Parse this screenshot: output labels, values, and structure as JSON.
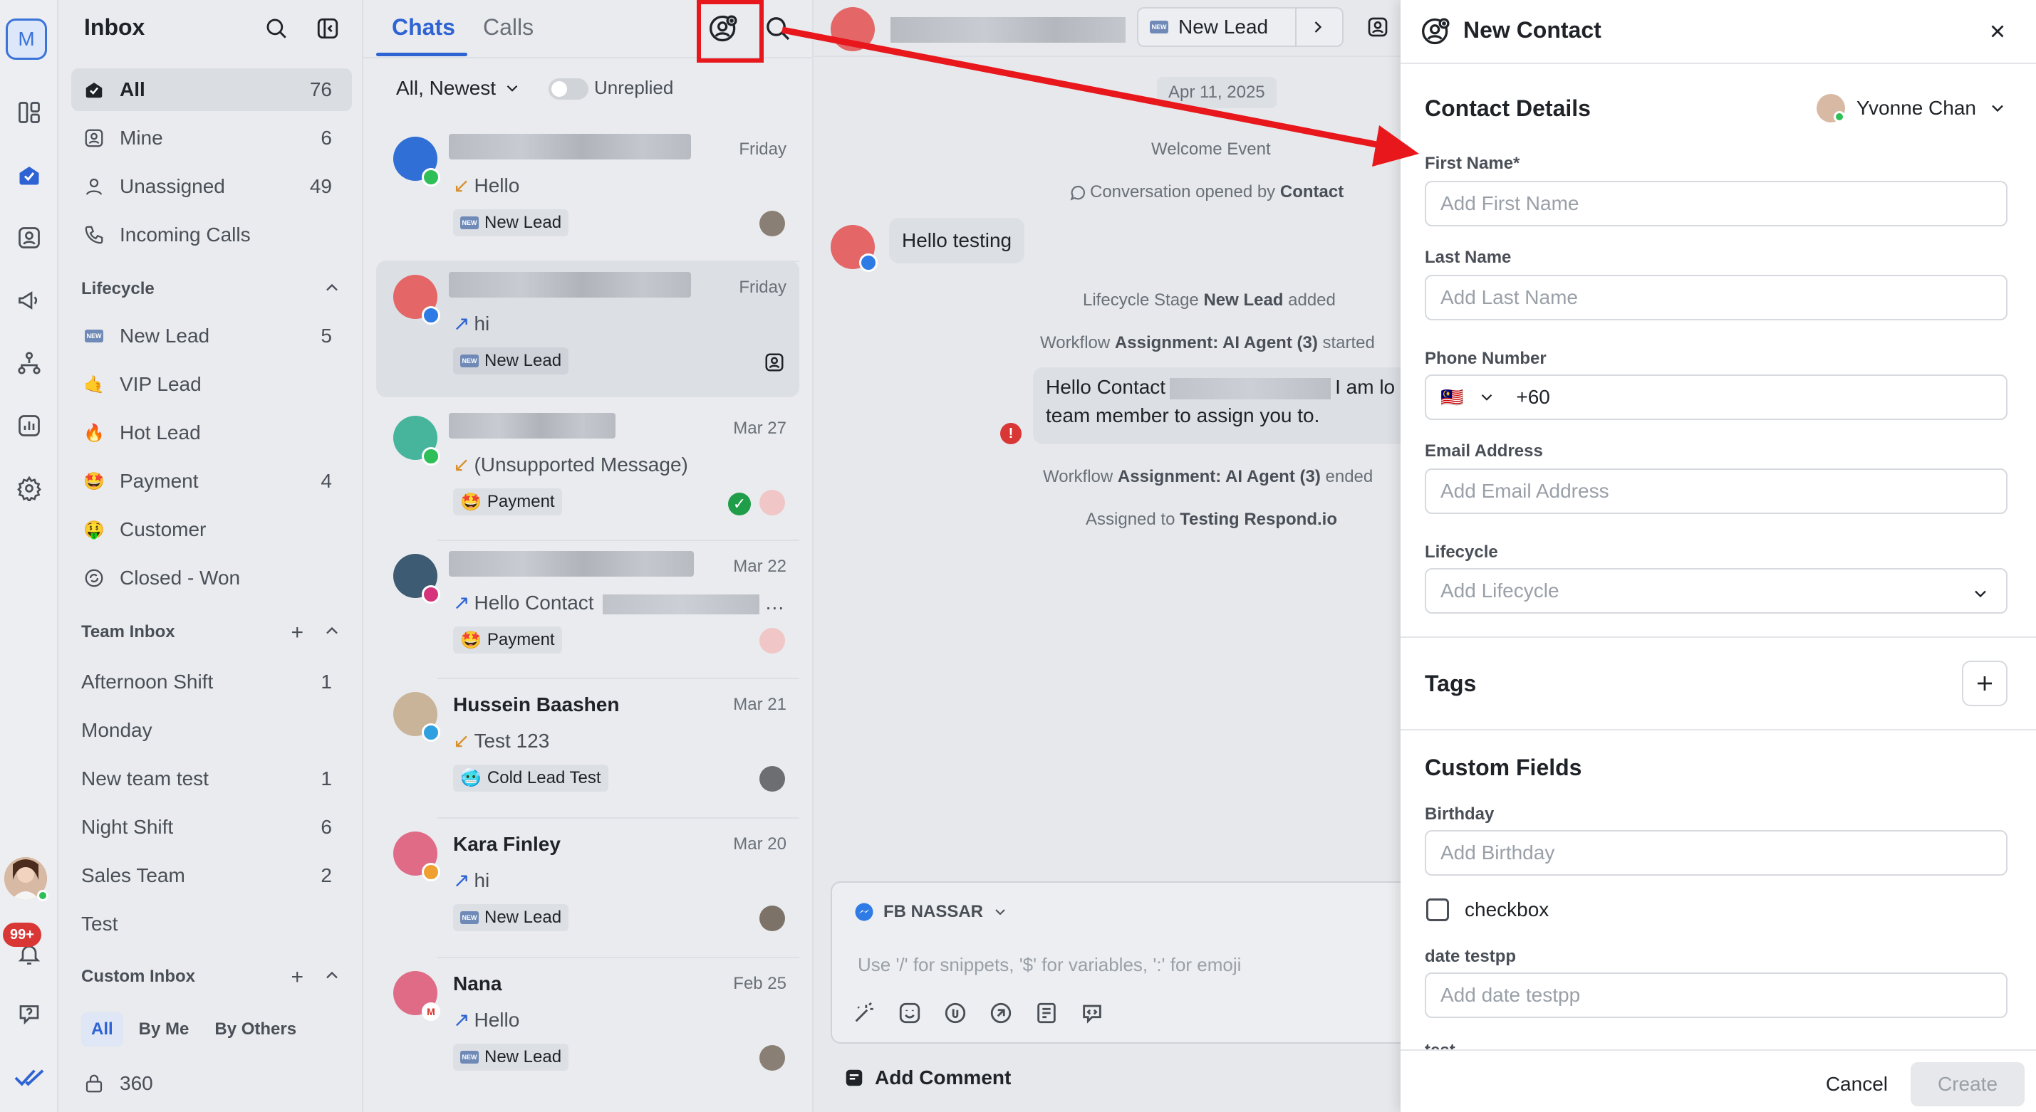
{
  "rail": {
    "workspace_initial": "M",
    "notification_count": "99+",
    "icons": [
      "dashboard-icon",
      "inbox-icon",
      "contacts-icon",
      "broadcast-icon",
      "workflows-icon",
      "reports-icon",
      "settings-icon",
      "help-icon",
      "brand-check-icon"
    ]
  },
  "inbox": {
    "title": "Inbox",
    "views": [
      {
        "label": "All",
        "count": "76"
      },
      {
        "label": "Mine",
        "count": "6"
      },
      {
        "label": "Unassigned",
        "count": "49"
      },
      {
        "label": "Incoming Calls",
        "count": ""
      }
    ],
    "lifecycle_header": "Lifecycle",
    "lifecycle": [
      {
        "label": "New Lead",
        "count": "5",
        "emoji": "🆕"
      },
      {
        "label": "VIP Lead",
        "count": "",
        "emoji": "🤙"
      },
      {
        "label": "Hot Lead",
        "count": "",
        "emoji": "🔥"
      },
      {
        "label": "Payment",
        "count": "4",
        "emoji": "🤩"
      },
      {
        "label": "Customer",
        "count": "",
        "emoji": "🤑"
      },
      {
        "label": "Closed - Won",
        "count": "",
        "emoji": ""
      }
    ],
    "team_header": "Team Inbox",
    "teams": [
      {
        "label": "Afternoon Shift",
        "count": "1"
      },
      {
        "label": "Monday",
        "count": ""
      },
      {
        "label": "New team test",
        "count": "1"
      },
      {
        "label": "Night Shift",
        "count": "6"
      },
      {
        "label": "Sales Team",
        "count": "2"
      },
      {
        "label": "Test",
        "count": ""
      }
    ],
    "custom_header": "Custom Inbox",
    "custom_tabs": [
      "All",
      "By Me",
      "By Others"
    ],
    "custom_items": [
      {
        "label": "360"
      }
    ]
  },
  "chats": {
    "tabs": [
      "Chats",
      "Calls"
    ],
    "filter_label": "All, Newest",
    "unreplied_label": "Unreplied",
    "items": [
      {
        "name": "",
        "date": "Friday",
        "message": "Hello",
        "direction": "in",
        "tag": "New Lead",
        "tag_emoji": "🆕"
      },
      {
        "name": "",
        "date": "Friday",
        "message": "hi",
        "direction": "out",
        "tag": "New Lead",
        "tag_emoji": "🆕"
      },
      {
        "name": "",
        "date": "Mar 27",
        "message": "(Unsupported Message)",
        "direction": "in",
        "tag": "Payment",
        "tag_emoji": "🤩"
      },
      {
        "name": "",
        "date": "Mar 22",
        "message": "Hello Contact",
        "direction": "out",
        "tag": "Payment",
        "tag_emoji": "🤩"
      },
      {
        "name": "Hussein Baashen",
        "date": "Mar 21",
        "message": "Test 123",
        "direction": "in",
        "tag": "Cold Lead Test",
        "tag_emoji": "🥶"
      },
      {
        "name": "Kara Finley",
        "date": "Mar 20",
        "message": "hi",
        "direction": "out",
        "tag": "New Lead",
        "tag_emoji": "🆕"
      },
      {
        "name": "Nana",
        "date": "Feb 25",
        "message": "Hello",
        "direction": "out",
        "tag": "New Lead",
        "tag_emoji": "🆕"
      }
    ]
  },
  "conversation": {
    "header_lifecycle": "New Lead",
    "date_chip": "Apr 11, 2025",
    "welcome_event": "Welcome Event",
    "opened_prefix": "Conversation opened by",
    "opened_by": "Contact",
    "incoming_message": "Hello testing",
    "lifecycle_prefix": "Lifecycle Stage",
    "lifecycle_stage": "New Lead",
    "lifecycle_suffix": "added",
    "workflow_prefix": "Workflow",
    "workflow_name": "Assignment: AI Agent (3)",
    "workflow_started": "started",
    "workflow_ended": "ended",
    "outgoing_line1_a": "Hello Contact",
    "outgoing_line1_b": "I am lo",
    "outgoing_line2": "team member to assign you to.",
    "assigned_prefix": "Assigned to",
    "assigned_to": "Testing Respond.io",
    "composer_channel": "FB NASSAR",
    "composer_placeholder": "Use '/' for snippets, '$' for variables, ':' for emoji",
    "add_comment": "Add Comment"
  },
  "new_contact": {
    "title": "New Contact",
    "section_details": "Contact Details",
    "owner_name": "Yvonne Chan",
    "first_name_label": "First Name*",
    "first_name_placeholder": "Add First Name",
    "last_name_label": "Last Name",
    "last_name_placeholder": "Add Last Name",
    "phone_label": "Phone Number",
    "phone_flag": "🇲🇾",
    "phone_value": "+60",
    "email_label": "Email Address",
    "email_placeholder": "Add Email Address",
    "lifecycle_label": "Lifecycle",
    "lifecycle_placeholder": "Add Lifecycle",
    "tags_title": "Tags",
    "custom_fields_title": "Custom Fields",
    "birthday_label": "Birthday",
    "birthday_placeholder": "Add Birthday",
    "checkbox_label": "checkbox",
    "checkbox_checked": false,
    "date_test_label": "date testpp",
    "date_test_placeholder": "Add date testpp",
    "next_label_cut": "test",
    "cancel_label": "Cancel",
    "create_label": "Create"
  },
  "colors": {
    "accent": "#2e63d3",
    "annotation_red": "#e8171b",
    "online": "#2fbf58",
    "badge_red": "#d93636"
  }
}
